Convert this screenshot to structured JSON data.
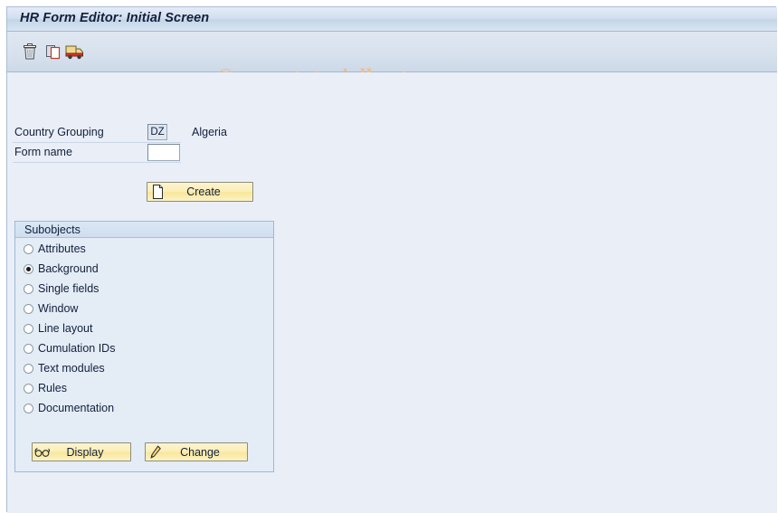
{
  "window": {
    "title": "HR Form Editor: Initial Screen"
  },
  "watermark": {
    "text": "© www.tutorialkart.com"
  },
  "toolbar": {
    "buttons": [
      {
        "name": "delete-icon",
        "tooltip": "Delete"
      },
      {
        "name": "copy-icon",
        "tooltip": "Copy"
      },
      {
        "name": "truck-icon",
        "tooltip": "Transport"
      }
    ]
  },
  "form": {
    "country_grouping": {
      "label": "Country Grouping",
      "value": "DZ",
      "description": "Algeria"
    },
    "form_name": {
      "label": "Form name",
      "value": "",
      "placeholder": ""
    },
    "create_button": {
      "label": "Create",
      "icon": "new-document-icon"
    }
  },
  "subobjects": {
    "title": "Subobjects",
    "options": [
      {
        "label": "Attributes",
        "selected": false
      },
      {
        "label": "Background",
        "selected": true
      },
      {
        "label": "Single fields",
        "selected": false
      },
      {
        "label": "Window",
        "selected": false
      },
      {
        "label": "Line layout",
        "selected": false
      },
      {
        "label": "Cumulation IDs",
        "selected": false
      },
      {
        "label": "Text modules",
        "selected": false
      },
      {
        "label": "Rules",
        "selected": false
      },
      {
        "label": "Documentation",
        "selected": false
      }
    ],
    "display_button": {
      "label": "Display",
      "icon": "glasses-icon"
    },
    "change_button": {
      "label": "Change",
      "icon": "pencil-icon"
    }
  },
  "colors": {
    "window_background": "#e9eef7",
    "title_text": "#12203c",
    "button_yellow": "#fbeeb6",
    "watermark": "#f0be8e",
    "group_border": "#9fb9d4"
  }
}
